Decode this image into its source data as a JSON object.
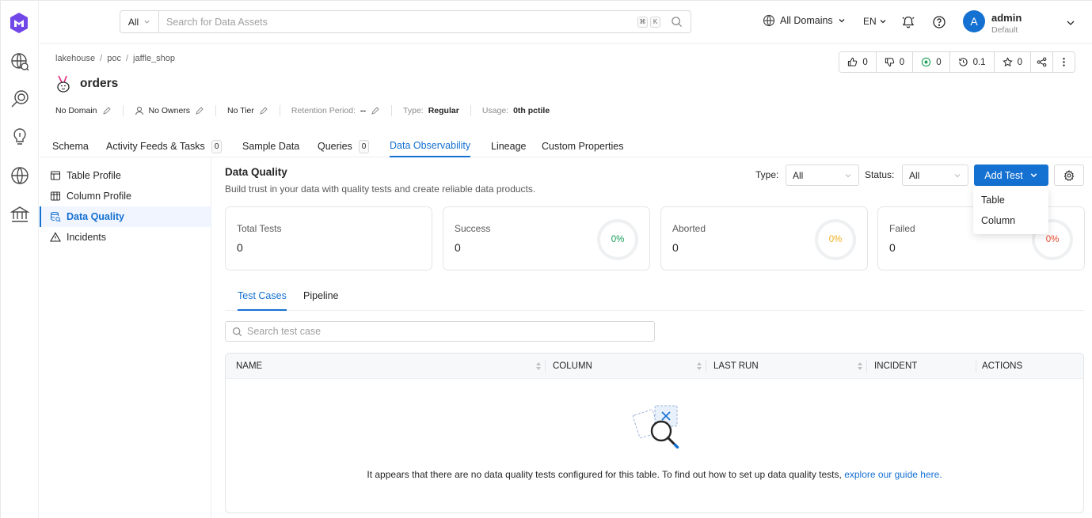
{
  "topbar": {
    "search_scope": "All",
    "search_placeholder": "Search for Data Assets",
    "shortcut_keys": [
      "⌘",
      "K"
    ],
    "domain_selector": "All Domains",
    "language": "EN",
    "user_name": "admin",
    "user_role": "Default",
    "avatar_initial": "A"
  },
  "breadcrumb": [
    "lakehouse",
    "poc",
    "jaffle_shop"
  ],
  "entity": {
    "name": "orders"
  },
  "meta": {
    "domain": "No Domain",
    "owners": "No Owners",
    "tier": "No Tier",
    "retention_label": "Retention Period:",
    "retention_value": "--",
    "type_label": "Type:",
    "type_value": "Regular",
    "usage_label": "Usage:",
    "usage_value": "0th pctile"
  },
  "actions": {
    "likes": "0",
    "dislikes": "0",
    "votes": "0",
    "version": "0.1",
    "follows": "0"
  },
  "tabs": [
    {
      "label": "Schema"
    },
    {
      "label": "Activity Feeds & Tasks",
      "count": "0"
    },
    {
      "label": "Sample Data"
    },
    {
      "label": "Queries",
      "count": "0"
    },
    {
      "label": "Data Observability"
    },
    {
      "label": "Lineage"
    },
    {
      "label": "Custom Properties"
    }
  ],
  "leftnav": [
    {
      "label": "Table Profile"
    },
    {
      "label": "Column Profile"
    },
    {
      "label": "Data Quality"
    },
    {
      "label": "Incidents"
    }
  ],
  "data_quality": {
    "title": "Data Quality",
    "subtitle": "Build trust in your data with quality tests and create reliable data products.",
    "type_label": "Type",
    "type_value": "All",
    "status_label": "Status",
    "status_value": "All",
    "add_test_label": "Add Test",
    "add_test_options": [
      "Table",
      "Column"
    ]
  },
  "stats": [
    {
      "label": "Total Tests",
      "value": "0"
    },
    {
      "label": "Success",
      "value": "0",
      "percent": "0%",
      "color": "#18a058"
    },
    {
      "label": "Aborted",
      "value": "0",
      "percent": "0%",
      "color": "#f2b01e"
    },
    {
      "label": "Failed",
      "value": "0",
      "percent": "0%",
      "color": "#e5452a"
    }
  ],
  "subtabs": [
    {
      "label": "Test Cases"
    },
    {
      "label": "Pipeline"
    }
  ],
  "test_case_search_placeholder": "Search test case",
  "table": {
    "columns": [
      "NAME",
      "COLUMN",
      "LAST RUN",
      "INCIDENT",
      "ACTIONS"
    ],
    "empty_message": "It appears that there are no data quality tests configured for this table. To find out how to set up data quality tests,",
    "empty_link": "explore our guide here."
  },
  "colors": {
    "primary": "#1470d1",
    "border": "#d9d9d9"
  }
}
